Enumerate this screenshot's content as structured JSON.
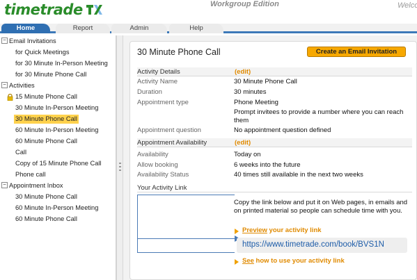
{
  "header": {
    "logo_text": "timetrade",
    "edition": "Workgroup Edition",
    "welcome": "Welco"
  },
  "tabs": [
    {
      "label": "Home",
      "active": true
    },
    {
      "label": "Report",
      "active": false
    },
    {
      "label": "Admin",
      "active": false
    },
    {
      "label": "Help",
      "active": false
    }
  ],
  "sidebar": {
    "email_invitations": {
      "label": "Email Invitations",
      "items": [
        "for Quick Meetings",
        "for 30 Minute In-Person Meeting",
        "for 30 Minute Phone Call"
      ]
    },
    "activities": {
      "label": "Activities",
      "items": [
        "15 Minute Phone Call",
        "30 Minute In-Person Meeting",
        "30 Minute Phone Call",
        "60 Minute In-Person Meeting",
        "60 Minute Phone Call",
        "Call",
        "Copy of 15 Minute Phone Call",
        "Phone call"
      ],
      "selected": "30 Minute Phone Call"
    },
    "appointment_inbox": {
      "label": "Appointment Inbox",
      "items": [
        "30 Minute Phone Call",
        "60 Minute In-Person Meeting",
        "60 Minute Phone Call"
      ]
    }
  },
  "main": {
    "title": "30 Minute Phone Call",
    "cta_label": "Create an Email Invitation",
    "activity_details": {
      "title": "Activity Details",
      "edit": "(edit)",
      "rows": [
        {
          "label": "Activity Name",
          "value": "30 Minute Phone Call"
        },
        {
          "label": "Duration",
          "value": "30 minutes"
        },
        {
          "label": "Appointment type",
          "value": "Phone Meeting"
        },
        {
          "label": "",
          "value": "Prompt invitees to provide a number where you can reach them"
        },
        {
          "label": "Appointment question",
          "value": "No appointment question defined"
        }
      ]
    },
    "availability": {
      "title": "Appointment Availability",
      "edit": "(edit)",
      "rows": [
        {
          "label": "Availability",
          "value": "Today on"
        },
        {
          "label": "Allow booking",
          "value": "6 weeks into the future"
        },
        {
          "label": "Availability Status",
          "value": "40 times still available in the next two weeks"
        }
      ]
    },
    "activity_link": {
      "title": "Your Activity Link",
      "instructions": "Copy the link below and put it on Web pages, in emails and on printed material so people can schedule time with you.",
      "preview_link": "Preview",
      "preview_rest": " your activity link",
      "url": "https://www.timetrade.com/book/BVS1N",
      "see_link": "See",
      "see_rest": " how to use your activity link"
    }
  },
  "colors": {
    "accent_blue": "#2f6fb2",
    "accent_orange": "#f7a800",
    "selection": "#ffd24d",
    "logo_green": "#2a8c2a"
  }
}
